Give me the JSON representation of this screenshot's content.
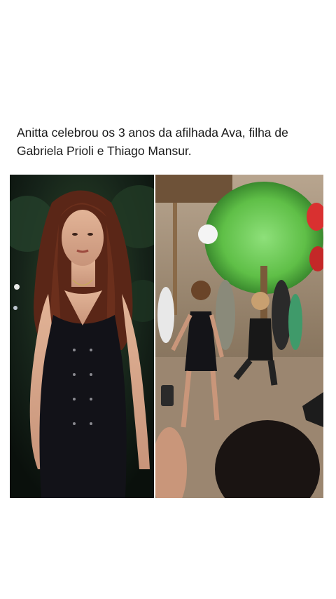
{
  "post": {
    "caption": "Anitta celebrou os 3 anos da afilhada Ava, filha de Gabriela Prioli e Thiago Mansur."
  },
  "photos": [
    {
      "icon": "portrait-photo"
    },
    {
      "icon": "party-dance-photo"
    }
  ],
  "colors": {
    "background": "#ffffff",
    "text": "#1a1a1a",
    "dress": "#121218",
    "hair": "#6b2f1c",
    "foliage": "#5fbf47"
  }
}
